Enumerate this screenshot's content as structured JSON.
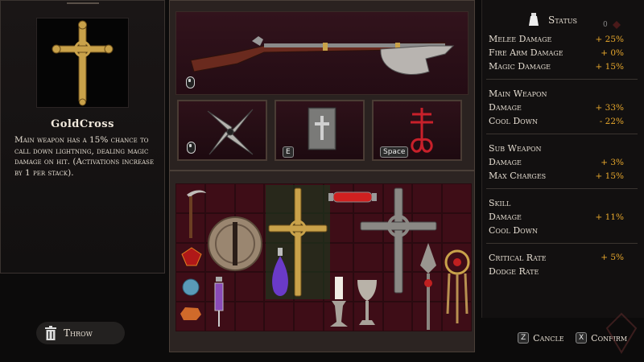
{
  "item": {
    "name": "GoldCross",
    "description": "Main weapon has a 15% chance to call down lightning, dealing magic damage on hit. (Activations increase by 1 per stack)."
  },
  "throw": {
    "label": "Throw"
  },
  "keys": {
    "subweapon": "E",
    "skill": "Space"
  },
  "status": {
    "title": "Status",
    "top_badge": "0",
    "groups": [
      {
        "stats": [
          {
            "label": "Melee Damage",
            "value": "+ 25%"
          },
          {
            "label": "Fire Arm Damage",
            "value": "+ 0%"
          },
          {
            "label": "Magic Damage",
            "value": "+ 15%"
          }
        ]
      },
      {
        "header": "Main Weapon",
        "stats": [
          {
            "label": "Damage",
            "value": "+ 33%"
          },
          {
            "label": "Cool Down",
            "value": "- 22%"
          }
        ]
      },
      {
        "header": "Sub Weapon",
        "stats": [
          {
            "label": "Damage",
            "value": "+ 3%"
          },
          {
            "label": "Max Charges",
            "value": "+ 15%"
          }
        ]
      },
      {
        "header": "Skill",
        "stats": [
          {
            "label": "Damage",
            "value": "+ 11%"
          },
          {
            "label": "Cool Down",
            "value": ""
          }
        ]
      },
      {
        "stats": [
          {
            "label": "Critical Rate",
            "value": "+ 5%"
          },
          {
            "label": "Dodge Rate",
            "value": ""
          }
        ]
      }
    ]
  },
  "footer": {
    "cancel_key": "Z",
    "cancel_label": "Cancle",
    "confirm_key": "X",
    "confirm_label": "Confirm"
  },
  "colors": {
    "accent": "#e8a82c",
    "slot_red": "#3e0d17",
    "gold": "#c9a24a"
  }
}
